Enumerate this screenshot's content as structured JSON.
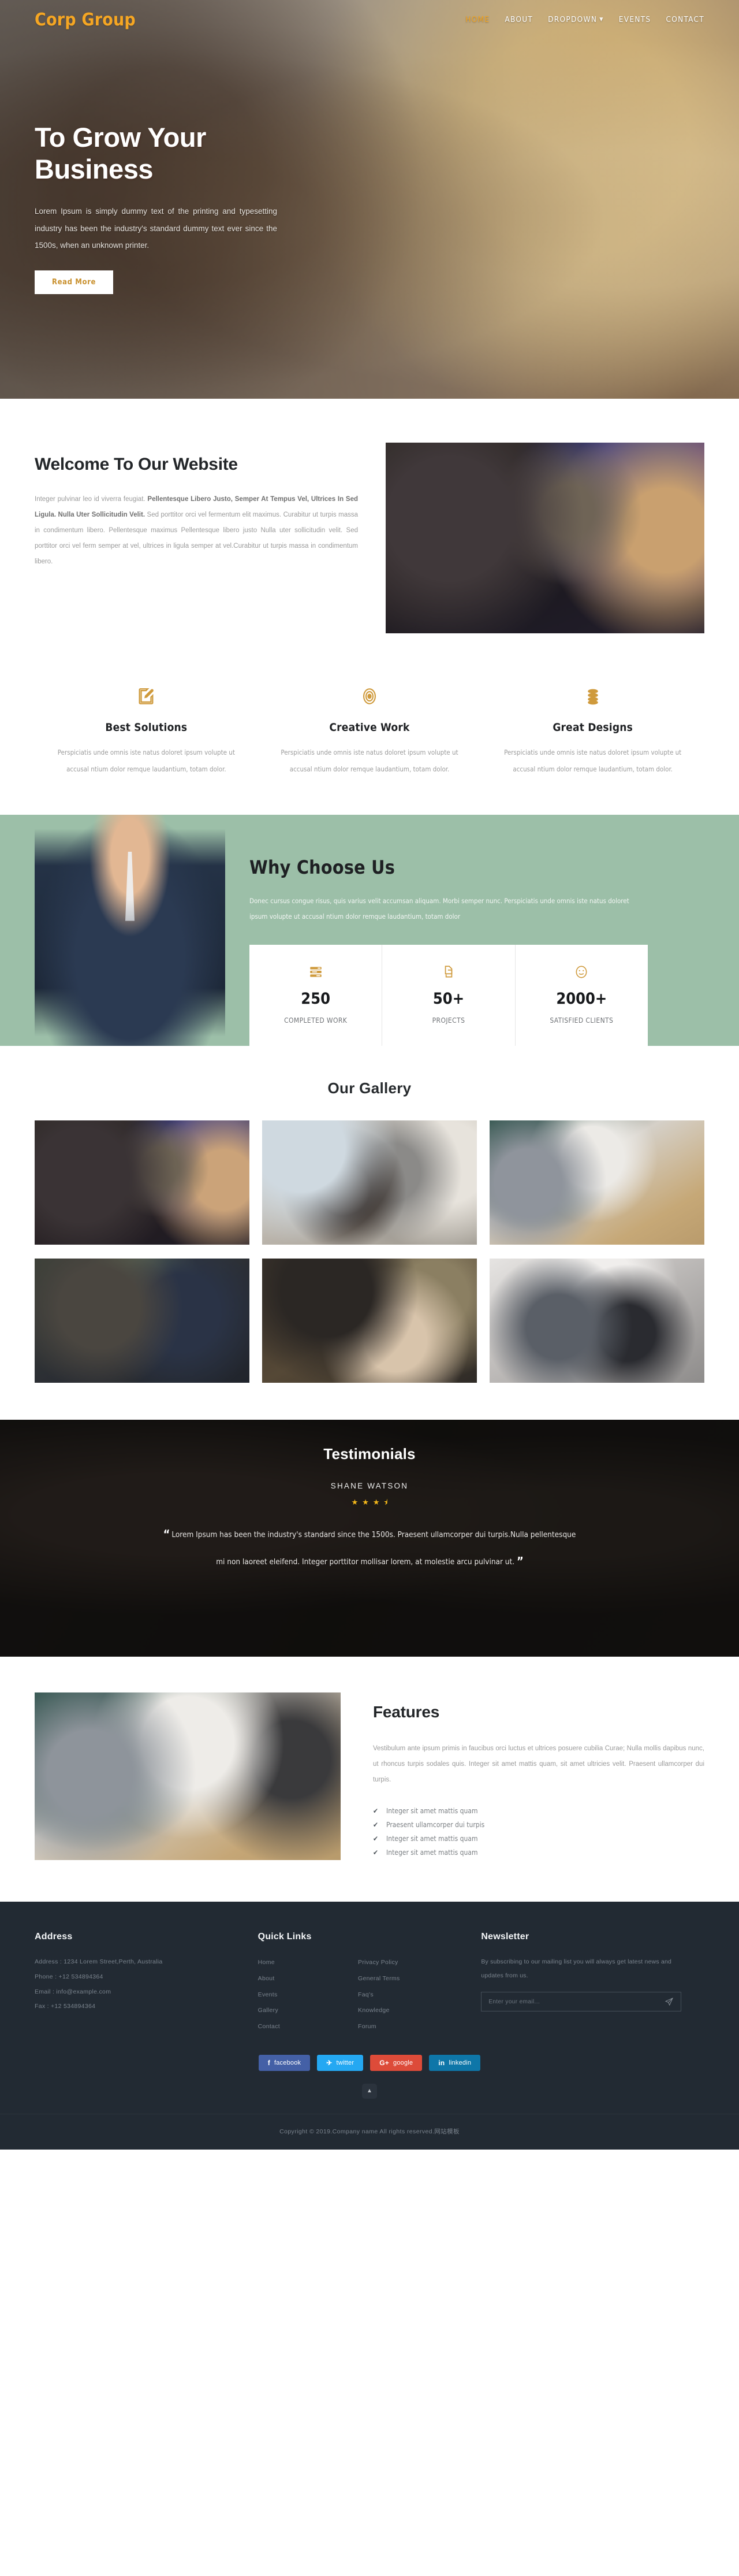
{
  "header": {
    "brand": "Corp Group",
    "nav": [
      {
        "label": "HOME",
        "active": true,
        "caret": false
      },
      {
        "label": "ABOUT",
        "active": false,
        "caret": false
      },
      {
        "label": "DROPDOWN",
        "active": false,
        "caret": true
      },
      {
        "label": "EVENTS",
        "active": false,
        "caret": false
      },
      {
        "label": "CONTACT",
        "active": false,
        "caret": false
      }
    ]
  },
  "hero": {
    "title": "To Grow Your Business",
    "paragraph": "Lorem Ipsum is simply dummy text of the printing and typesetting industry has been the industry's standard dummy text ever since the 1500s, when an unknown printer.",
    "button": "Read More"
  },
  "welcome": {
    "title": "Welcome To Our Website",
    "lead_plain_1": "Integer pulvinar leo id viverra feugiat. ",
    "lead_bold": "Pellentesque Libero Justo, Semper At Tempus Vel, Ultrices In Sed Ligula. Nulla Uter Sollicitudin Velit.",
    "lead_plain_2": " Sed porttitor orci vel fermentum elit maximus. Curabitur ut turpis massa in condimentum libero. Pellentesque maximus Pellentesque libero justo Nulla uter sollicitudin velit. Sed porttitor orci vel ferm semper at vel, ultrices in ligula semper at vel.Curabitur ut turpis massa in condimentum libero."
  },
  "services": [
    {
      "icon": "pencil-square-icon",
      "title": "Best Solutions",
      "text": "Perspiciatis unde omnis iste natus doloret ipsum volupte ut accusal ntium dolor remque laudantium, totam dolor."
    },
    {
      "icon": "bullseye-target-icon",
      "title": "Creative Work",
      "text": "Perspiciatis unde omnis iste natus doloret ipsum volupte ut accusal ntium dolor remque laudantium, totam dolor."
    },
    {
      "icon": "coin-stack-icon",
      "title": "Great Designs",
      "text": "Perspiciatis unde omnis iste natus doloret ipsum volupte ut accusal ntium dolor remque laudantium, totam dolor."
    }
  ],
  "why": {
    "title": "Why Choose Us",
    "text": "Donec cursus congue risus, quis varius velit accumsan aliquam. Morbi semper nunc. Perspiciatis unde omnis iste natus doloret ipsum volupte ut accusal ntium dolor remque laudantium, totam dolor",
    "stats": [
      {
        "icon": "server-bars-icon",
        "number": "250",
        "label": "COMPLETED WORK"
      },
      {
        "icon": "copy-files-icon",
        "number": "50+",
        "label": "PROJECTS"
      },
      {
        "icon": "smiley-face-icon",
        "number": "2000+",
        "label": "SATISFIED CLIENTS"
      }
    ]
  },
  "gallery": {
    "title": "Our Gallery",
    "items": [
      "gallery-photo-cafe-meeting",
      "gallery-photo-team-laptop",
      "gallery-photo-conference-table",
      "gallery-photo-handshake-outdoor",
      "gallery-photo-handshake-desk",
      "gallery-photo-handshake-lobby"
    ]
  },
  "testimonials": {
    "title": "Testimonials",
    "author": "SHANE WATSON",
    "rating": 3.5,
    "stars": [
      "★",
      "★",
      "★",
      "⯨"
    ],
    "quote": "Lorem Ipsum has been the industry's standard since the 1500s. Praesent ullamcorper dui turpis.Nulla pellentesque mi non laoreet eleifend. Integer porttitor mollisar lorem, at molestie arcu pulvinar ut.",
    "quote_open": "“",
    "quote_close": "”"
  },
  "features": {
    "title": "Features",
    "text": "Vestibulum ante ipsum primis in faucibus orci luctus et ultrices posuere cubilia Curae; Nulla mollis dapibus nunc, ut rhoncus turpis sodales quis. Integer sit amet mattis quam, sit amet ultricies velit. Praesent ullamcorper dui turpis.",
    "checklist": [
      "Integer sit amet mattis quam",
      "Praesent ullamcorper dui turpis",
      "Integer sit amet mattis quam",
      "Integer sit amet mattis quam"
    ]
  },
  "footer": {
    "address": {
      "title": "Address",
      "lines": [
        "Address : 1234 Lorem Street,Perth, Australia",
        "Phone : +12 534894364",
        "Email : info@example.com",
        "Fax : +12 534894364"
      ]
    },
    "quick_links": {
      "title": "Quick Links",
      "col1": [
        "Home",
        "About",
        "Events",
        "Gallery",
        "Contact"
      ],
      "col2": [
        "Privacy Policy",
        "General Terms",
        "Faq's",
        "Knowledge",
        "Forum"
      ]
    },
    "newsletter": {
      "title": "Newsletter",
      "text": "By subscribing to our mailing list you will always get latest news and updates from us.",
      "placeholder": "Enter your email...",
      "value": "",
      "send_icon": "paper-plane-icon"
    },
    "socials": [
      {
        "name": "facebook",
        "glyph": "f",
        "color": "#4460a6"
      },
      {
        "name": "twitter",
        "glyph": "✈",
        "color": "#24a8f2"
      },
      {
        "name": "google",
        "glyph": "G+",
        "color": "#dd4b39"
      },
      {
        "name": "linkedin",
        "glyph": "in",
        "color": "#0e76a8"
      }
    ],
    "to_top_icon": "chevron-up-icon",
    "copyright": "Copyright © 2019.Company name All rights reserved.网站模板"
  },
  "colors": {
    "accent": "#f5a623",
    "gold": "#cf9a3c",
    "green": "#9cbfa8",
    "footer_bg": "#222a33"
  }
}
